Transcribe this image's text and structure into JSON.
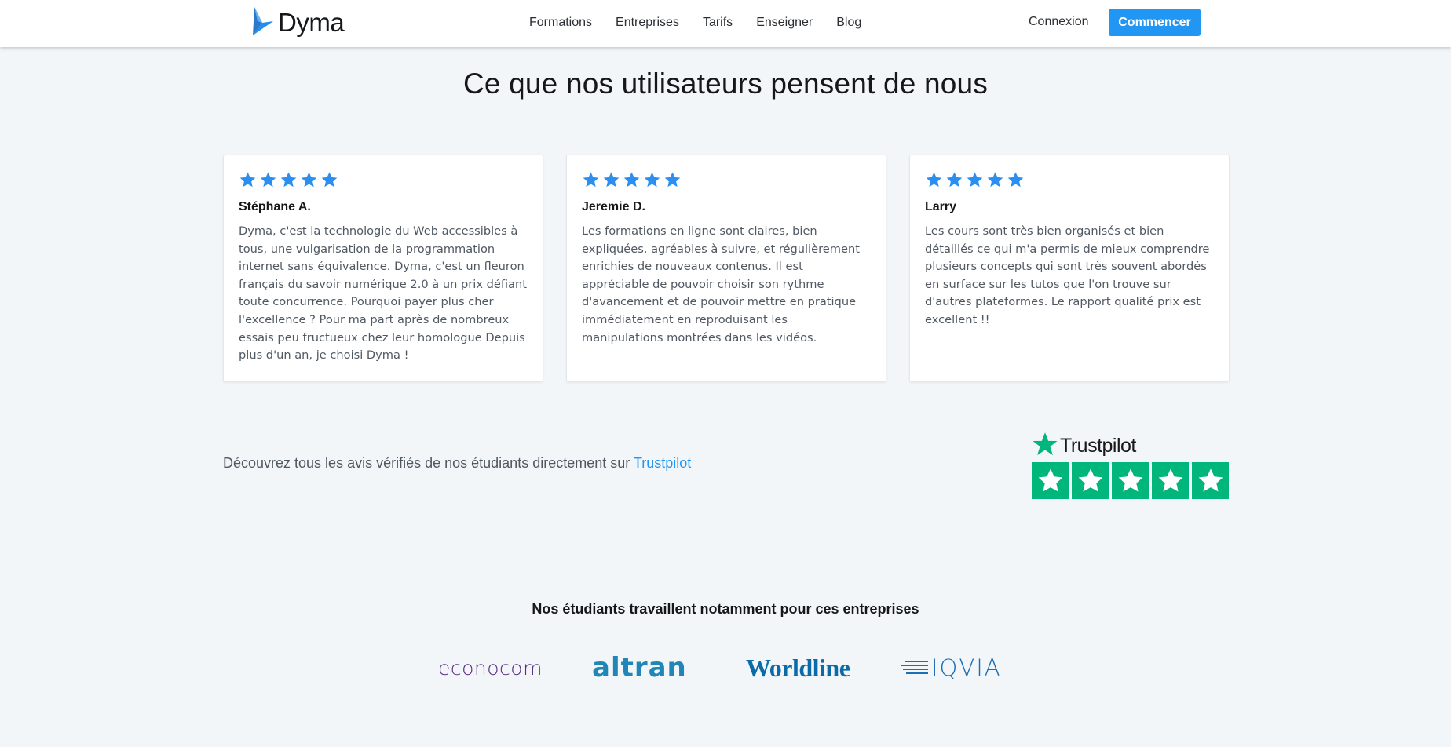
{
  "header": {
    "logo_text": "Dyma",
    "nav": [
      "Formations",
      "Entreprises",
      "Tarifs",
      "Enseigner",
      "Blog"
    ],
    "login": "Connexion",
    "cta": "Commencer"
  },
  "section": {
    "title": "Ce que nos utilisateurs pensent de nous"
  },
  "reviews": [
    {
      "rating": 5,
      "name": "Stéphane A.",
      "text": "Dyma, c'est la technologie du Web accessibles à tous, une vulgarisation de la programmation internet sans équivalence. Dyma, c'est un fleuron français du savoir numérique 2.0 à un prix défiant toute concurrence. Pourquoi payer plus cher l'excellence ? Pour ma part après de nombreux essais peu fructueux chez leur homologue Depuis plus d'un an, je choisi Dyma !"
    },
    {
      "rating": 5,
      "name": "Jeremie D.",
      "text": "Les formations en ligne sont claires, bien expliquées, agréables à suivre, et régulièrement enrichies de nouveaux contenus. Il est appréciable de pouvoir choisir son rythme d'avancement et de pouvoir mettre en pratique immédiatement en reproduisant les manipulations montrées dans les vidéos."
    },
    {
      "rating": 5,
      "name": "Larry",
      "text": "Les cours sont très bien organisés et bien détaillés ce qui m'a permis de mieux comprendre plusieurs concepts qui sont très souvent abordés en surface sur les tutos que l'on trouve sur d'autres plateformes. Le rapport qualité prix est excellent !!"
    }
  ],
  "trustpilot": {
    "text": "Découvrez tous les avis vérifiés de nos étudiants directement sur",
    "link": "Trustpilot",
    "brand": "Trustpilot",
    "rating": 5
  },
  "companies": {
    "title": "Nos étudiants travaillent notamment pour ces entreprises",
    "logos": [
      "econocom",
      "altran",
      "Worldline",
      "IQVIA"
    ]
  },
  "colors": {
    "accent": "#2196f3",
    "star_blue": "#2a8ff0",
    "trustpilot_green": "#00b67a",
    "background": "#f3f6f9"
  },
  "icons": {
    "logo": "dyma-bird-logo",
    "star": "star-icon",
    "trustpilot_star": "trustpilot-star-icon"
  }
}
